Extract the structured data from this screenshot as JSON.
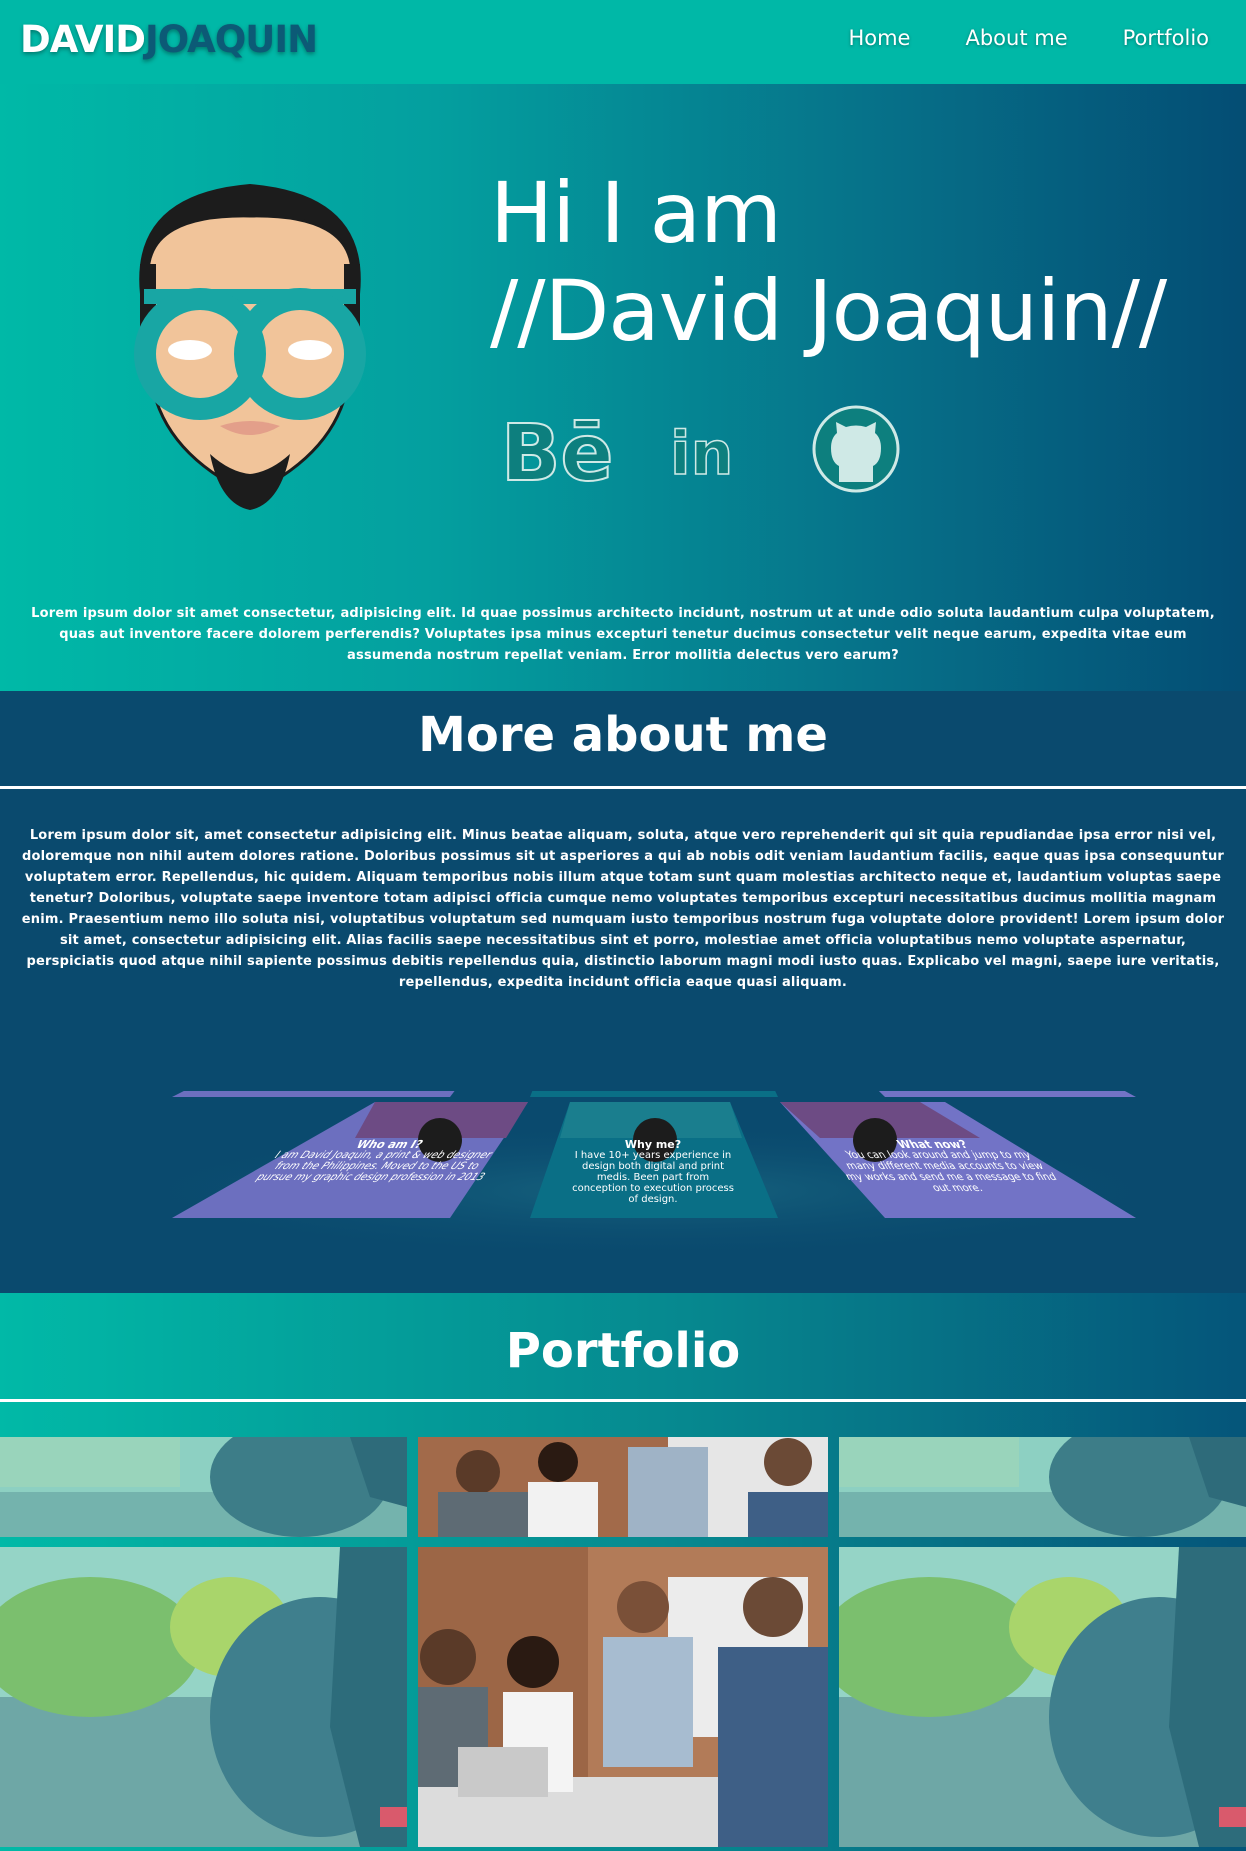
{
  "brand": {
    "first": "DAVID",
    "last": "JOAQUIN"
  },
  "nav": {
    "items": [
      "Home",
      "About me",
      "Portfolio"
    ]
  },
  "hero": {
    "line1": "Hi I am",
    "line2": "//David Joaquin//",
    "social": [
      "behance-icon",
      "linkedin-icon",
      "github-icon"
    ],
    "text": "Lorem ipsum dolor sit amet consectetur, adipisicing elit. Id quae possimus architecto incidunt, nostrum ut at unde odio soluta laudantium culpa voluptatem, quas aut inventore facere dolorem perferendis? Voluptates ipsa minus excepturi tenetur ducimus consectetur velit neque earum, expedita vitae eum assumenda nostrum repellat veniam. Error mollitia delectus vero earum?"
  },
  "about": {
    "title": "More about me",
    "text": "Lorem ipsum dolor sit, amet consectetur adipisicing elit. Minus beatae aliquam, soluta, atque vero reprehenderit qui sit quia repudiandae ipsa error nisi vel, doloremque non nihil autem dolores ratione. Doloribus possimus sit ut asperiores a qui ab nobis odit veniam laudantium facilis, eaque quas ipsa consequuntur voluptatem error. Repellendus, hic quidem. Aliquam temporibus nobis illum atque totam sunt quam molestias architecto neque et, laudantium voluptas saepe tenetur? Doloribus, voluptate saepe inventore totam adipisci officia cumque nemo voluptates temporibus excepturi necessitatibus ducimus mollitia magnam enim. Praesentium nemo illo soluta nisi, voluptatibus voluptatum sed numquam iusto temporibus nostrum fuga voluptate dolore provident! Lorem ipsum dolor sit amet, consectetur adipisicing elit. Alias facilis saepe necessitatibus sint et porro, molestiae amet officia voluptatibus nemo voluptate aspernatur, perspiciatis quod atque nihil sapiente possimus debitis repellendus quia, distinctio laborum magni modi iusto quas. Explicabo vel magni, saepe iure veritatis, repellendus, expedita incidunt officia eaque quasi aliquam.",
    "cards": [
      {
        "title": "Who am I?",
        "body": "I am David Joaquin, a print & web designer from the Philippines. Moved to the US to pursue my graphic design profession in 2013",
        "color": "#6c6fbf"
      },
      {
        "title": "Why me?",
        "body": "I have 10+ years experience in design both digital and print medis. Been part from conception to execution process of design.",
        "color": "#0a6f86"
      },
      {
        "title": "What now?",
        "body": "You can look around and jump to my many different media accounts to view my works and send me a message to find out more.",
        "color": "#7273c6"
      }
    ]
  },
  "portfolio": {
    "title": "Portfolio",
    "tiles": [
      "runner-photo",
      "team-meeting-photo",
      "runner-photo",
      "runner-photo",
      "team-meeting-photo",
      "runner-photo"
    ]
  },
  "colors": {
    "teal": "#00b8a7",
    "navy": "#0a4a6e",
    "brand_dark": "#0c5a76",
    "card_purple": "#6c6fbf"
  }
}
